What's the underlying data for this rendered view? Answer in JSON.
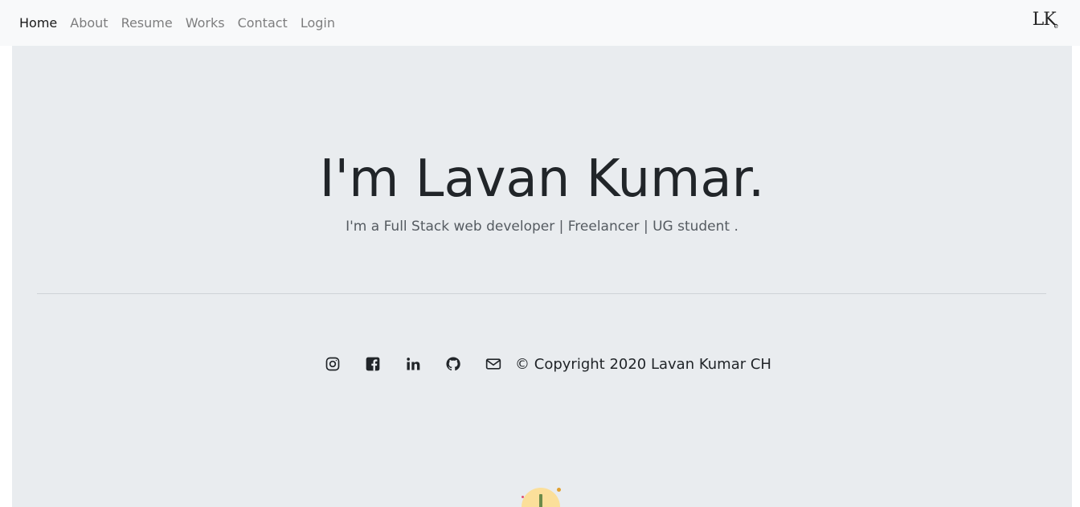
{
  "nav": {
    "items": [
      {
        "label": "Home",
        "active": true
      },
      {
        "label": "About",
        "active": false
      },
      {
        "label": "Resume",
        "active": false
      },
      {
        "label": "Works",
        "active": false
      },
      {
        "label": "Contact",
        "active": false
      },
      {
        "label": "Login",
        "active": false
      }
    ],
    "brand": "LK"
  },
  "hero": {
    "title": "I'm Lavan Kumar.",
    "subtitle": "I'm a Full Stack web developer | Freelancer | UG student .",
    "background": "#e9ecef"
  },
  "footer": {
    "icons": [
      "instagram-icon",
      "facebook-icon",
      "linkedin-icon",
      "github-icon",
      "email-icon"
    ],
    "copyright": "© Copyright 2020 Lavan Kumar CH"
  },
  "colors": {
    "navbar_bg": "#f8f9fa",
    "text_dark": "#212529",
    "text_muted": "#6c757d"
  }
}
